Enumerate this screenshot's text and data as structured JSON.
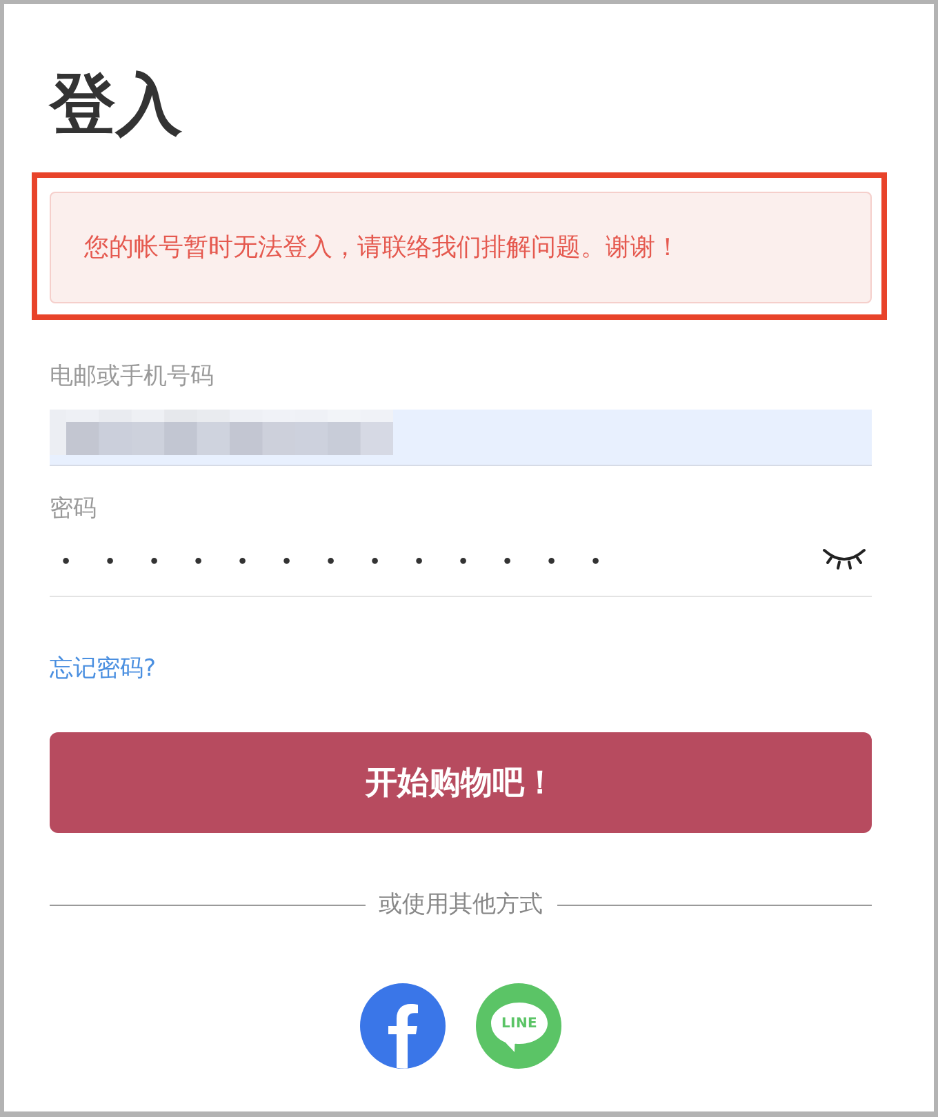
{
  "title": "登入",
  "error_alert": {
    "text": "您的帐号暂时无法登入，请联络我们排解问题。谢谢！",
    "highlighted": true
  },
  "email_field": {
    "label": "电邮或手机号码",
    "autofilled": true,
    "redacted": true
  },
  "password_field": {
    "label": "密码",
    "masked_value": "•••••••••••••",
    "revealed": false
  },
  "forgot_password_link": "忘记密码?",
  "submit_button": "开始购物吧！",
  "divider_text": "或使用其他方式",
  "social_logins": [
    {
      "kind": "facebook"
    },
    {
      "kind": "line",
      "label": "LINE"
    }
  ]
}
